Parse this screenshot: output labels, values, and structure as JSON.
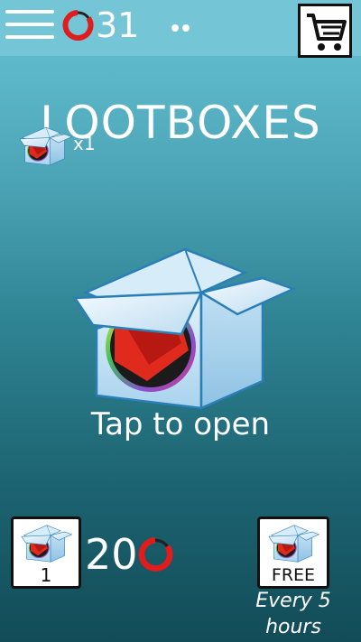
{
  "header": {
    "coins": "31"
  },
  "page": {
    "title": "LOOTBOXES",
    "owned_count": "x1",
    "tap_label": "Tap to open"
  },
  "shop": {
    "buy_quantity": "1",
    "price": "20",
    "free_label": "FREE",
    "free_note_line1": "Every 5",
    "free_note_line2": "hours"
  },
  "icons": {
    "menu": "hamburger-menu-icon",
    "coin": "red-coin-ring-icon",
    "cart": "shopping-cart-icon",
    "lootbox": "open-lootbox-icon"
  },
  "colors": {
    "topbar": "#74c6d6",
    "coin_red": "#e01c1c",
    "box_blue": "#bfe1f4",
    "button_border": "#111111"
  }
}
